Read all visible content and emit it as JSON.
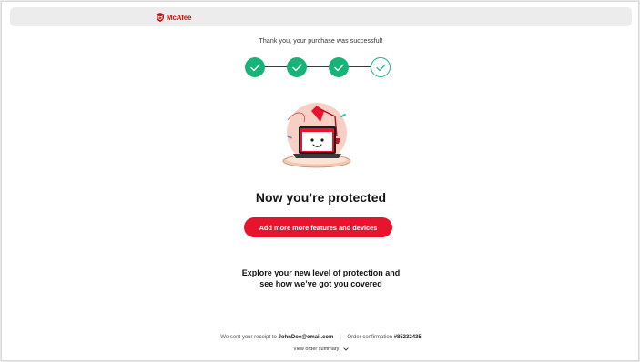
{
  "header": {
    "logo_text": "McAfee",
    "logo_icon": "mcafee-shield-icon"
  },
  "status": {
    "thank_you": "Thank you, your purchase was successful!"
  },
  "steps": [
    {
      "state": "done",
      "icon": "check-icon"
    },
    {
      "state": "done",
      "icon": "check-icon"
    },
    {
      "state": "done",
      "icon": "check-icon"
    },
    {
      "state": "current",
      "icon": "check-icon"
    }
  ],
  "main": {
    "title": "Now you’re protected",
    "cta_label": "Add more more features and devices",
    "explore_line1": "Explore your new level of protection and",
    "explore_line2": "see how we’ve got you covered"
  },
  "receipt": {
    "prefix": "We sent your receipt to",
    "email": "JohnDoe@email.com",
    "separator": "|",
    "order_label": "Order confirmation",
    "order_number": "#85232435"
  },
  "summary": {
    "label": "View order summary",
    "icon": "chevron-down-icon"
  },
  "colors": {
    "brand_red": "#e8132d",
    "success_green": "#17b47a",
    "logo_red": "#c01818"
  }
}
